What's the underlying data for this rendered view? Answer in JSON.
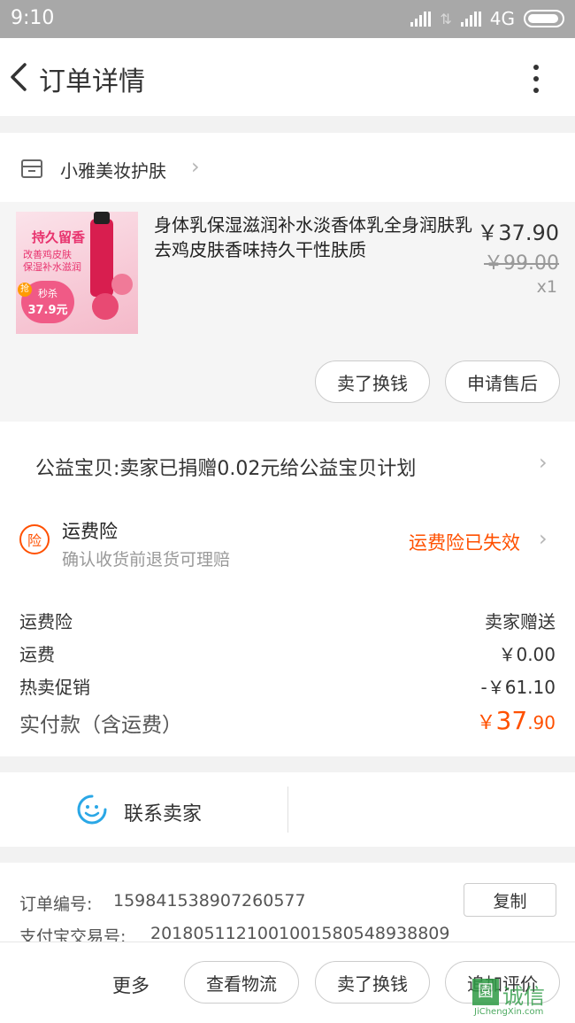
{
  "status_bar": {
    "time": "9:10",
    "network": "4G"
  },
  "header": {
    "title": "订单详情"
  },
  "shop": {
    "name": "小雅美妆护肤"
  },
  "product": {
    "title": "身体乳保湿滋润补水淡香体乳全身润肤乳去鸡皮肤香味持久干性肤质",
    "price": "￥37.90",
    "original_price": "￥99.00",
    "quantity": "x1",
    "thumb_text": {
      "line1": "持久留香",
      "line2": "改善鸡皮肤",
      "line3": "保湿补水滋润",
      "badge": "抢",
      "badge2": "秒杀",
      "badge_price": "37.9元"
    },
    "buttons": [
      "卖了换钱",
      "申请售后"
    ]
  },
  "charity": {
    "text": "公益宝贝:卖家已捐赠0.02元给公益宝贝计划"
  },
  "insurance": {
    "icon_text": "险",
    "title": "运费险",
    "subtitle": "确认收货前退货可理赔",
    "status": "运费险已失效"
  },
  "fees": [
    {
      "label": "运费险",
      "value": "卖家赠送"
    },
    {
      "label": "运费",
      "value": "￥0.00"
    },
    {
      "label": "热卖促销",
      "value": "-￥61.10"
    }
  ],
  "total": {
    "label": "实付款（含运费）",
    "symbol": "￥",
    "integer": "37",
    "decimal": ".90"
  },
  "contact": {
    "label": "联系卖家"
  },
  "order_info": {
    "order_no_label": "订单编号:",
    "order_no": "159841538907260577",
    "copy_label": "复制",
    "alipay_label": "支付宝交易号:",
    "alipay_no": "2018051121001001580548938809"
  },
  "bottom_bar": {
    "more": "更多",
    "buttons": [
      "查看物流",
      "卖了换钱",
      "追加评价"
    ]
  },
  "watermark": {
    "cn": "诚信",
    "en": "JiChengXin.com"
  },
  "colors": {
    "accent": "#ff5000",
    "contact_icon": "#2aa7e6"
  }
}
